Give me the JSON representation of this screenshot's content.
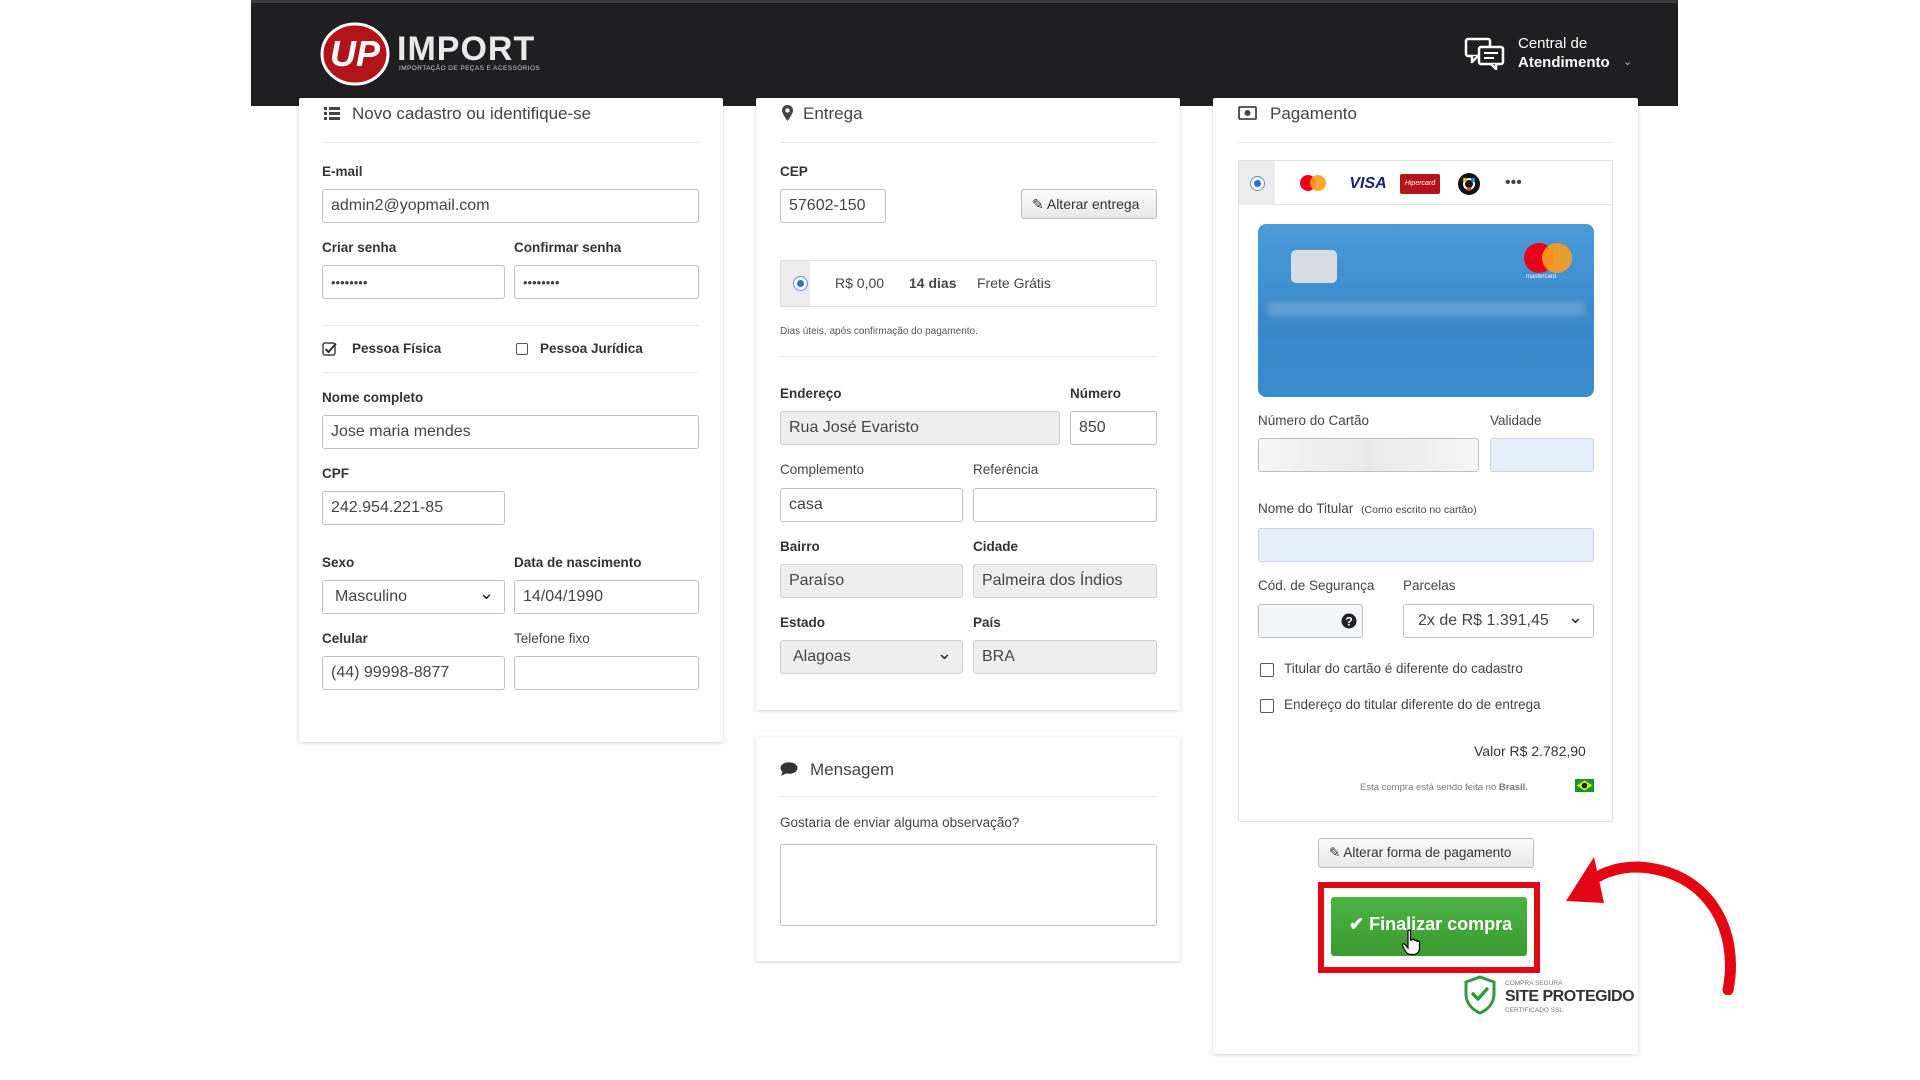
{
  "header": {
    "logo_text": "IMPORT",
    "logo_subtitle": "IMPORTAÇÃO DE PEÇAS E ACESSÓRIOS",
    "support_line1": "Central de",
    "support_line2": "Atendimento"
  },
  "register": {
    "title": "Novo cadastro ou identifique-se",
    "email_label": "E-mail",
    "email_value": "admin2@yopmail.com",
    "password_label": "Criar senha",
    "password_value": "••••••••",
    "confirm_label": "Confirmar senha",
    "confirm_value": "••••••••",
    "person_physical": "Pessoa Física",
    "person_legal": "Pessoa Jurídica",
    "fullname_label": "Nome completo",
    "fullname_value": "Jose maria mendes",
    "cpf_label": "CPF",
    "cpf_value": "242.954.221-85",
    "sex_label": "Sexo",
    "sex_value": "Masculino",
    "birth_label": "Data de nascimento",
    "birth_value": "14/04/1990",
    "cell_label": "Celular",
    "cell_value": "(44) 99998-8877",
    "phone_label": "Telefone fixo",
    "phone_value": ""
  },
  "delivery": {
    "title": "Entrega",
    "cep_label": "CEP",
    "cep_value": "57602-150",
    "change_button": "Alterar entrega",
    "shipping_price": "R$ 0,00",
    "shipping_days": "14 dias",
    "shipping_name": "Frete Grátis",
    "shipping_note": "Dias úteis, após confirmação do pagamento.",
    "address_label": "Endereço",
    "address_value": "Rua José Evaristo",
    "number_label": "Número",
    "number_value": "850",
    "complement_label": "Complemento",
    "complement_value": "casa",
    "reference_label": "Referência",
    "reference_value": "",
    "district_label": "Bairro",
    "district_value": "Paraíso",
    "city_label": "Cidade",
    "city_value": "Palmeira dos Índios",
    "state_label": "Estado",
    "state_value": "Alagoas",
    "country_label": "País",
    "country_value": "BRA"
  },
  "message": {
    "title": "Mensagem",
    "prompt": "Gostaria de enviar alguma observação?",
    "value": ""
  },
  "payment": {
    "title": "Pagamento",
    "brands": [
      "mastercard-icon",
      "visa-icon",
      "hipercard-icon",
      "elo-icon"
    ],
    "visa_label": "VISA",
    "hipercard_label": "Hipercard",
    "more": "•••",
    "card_brand_text": "mastercard",
    "card_number_label": "Número do Cartão",
    "validity_label": "Validade",
    "holder_label": "Nome do Titular",
    "holder_hint": "(Como escrito no cartão)",
    "cvv_label": "Cód. de Segurança",
    "installments_label": "Parcelas",
    "installments_value": "2x de R$ 1.391,45",
    "holder_diff": "Titular do cartão é diferente do cadastro",
    "address_diff": "Endereço do titular diferente do de entrega",
    "total": "Valor R$ 2.782,90",
    "brazil_note_prefix": "Esta compra está sendo feita no",
    "brazil_note_country": "Brasil.",
    "change_payment": "Alterar forma de pagamento",
    "finish": "Finalizar compra",
    "secure_small": "COMPRA SEGURA",
    "secure_main": "SITE PROTEGIDO",
    "secure_sub": "CERTIFICADO SSL"
  },
  "colors": {
    "header_bg": "#1f1f21",
    "finish_green": "#44a73a",
    "highlight_red": "#e30613",
    "card_blue": "#3b8fd0"
  }
}
